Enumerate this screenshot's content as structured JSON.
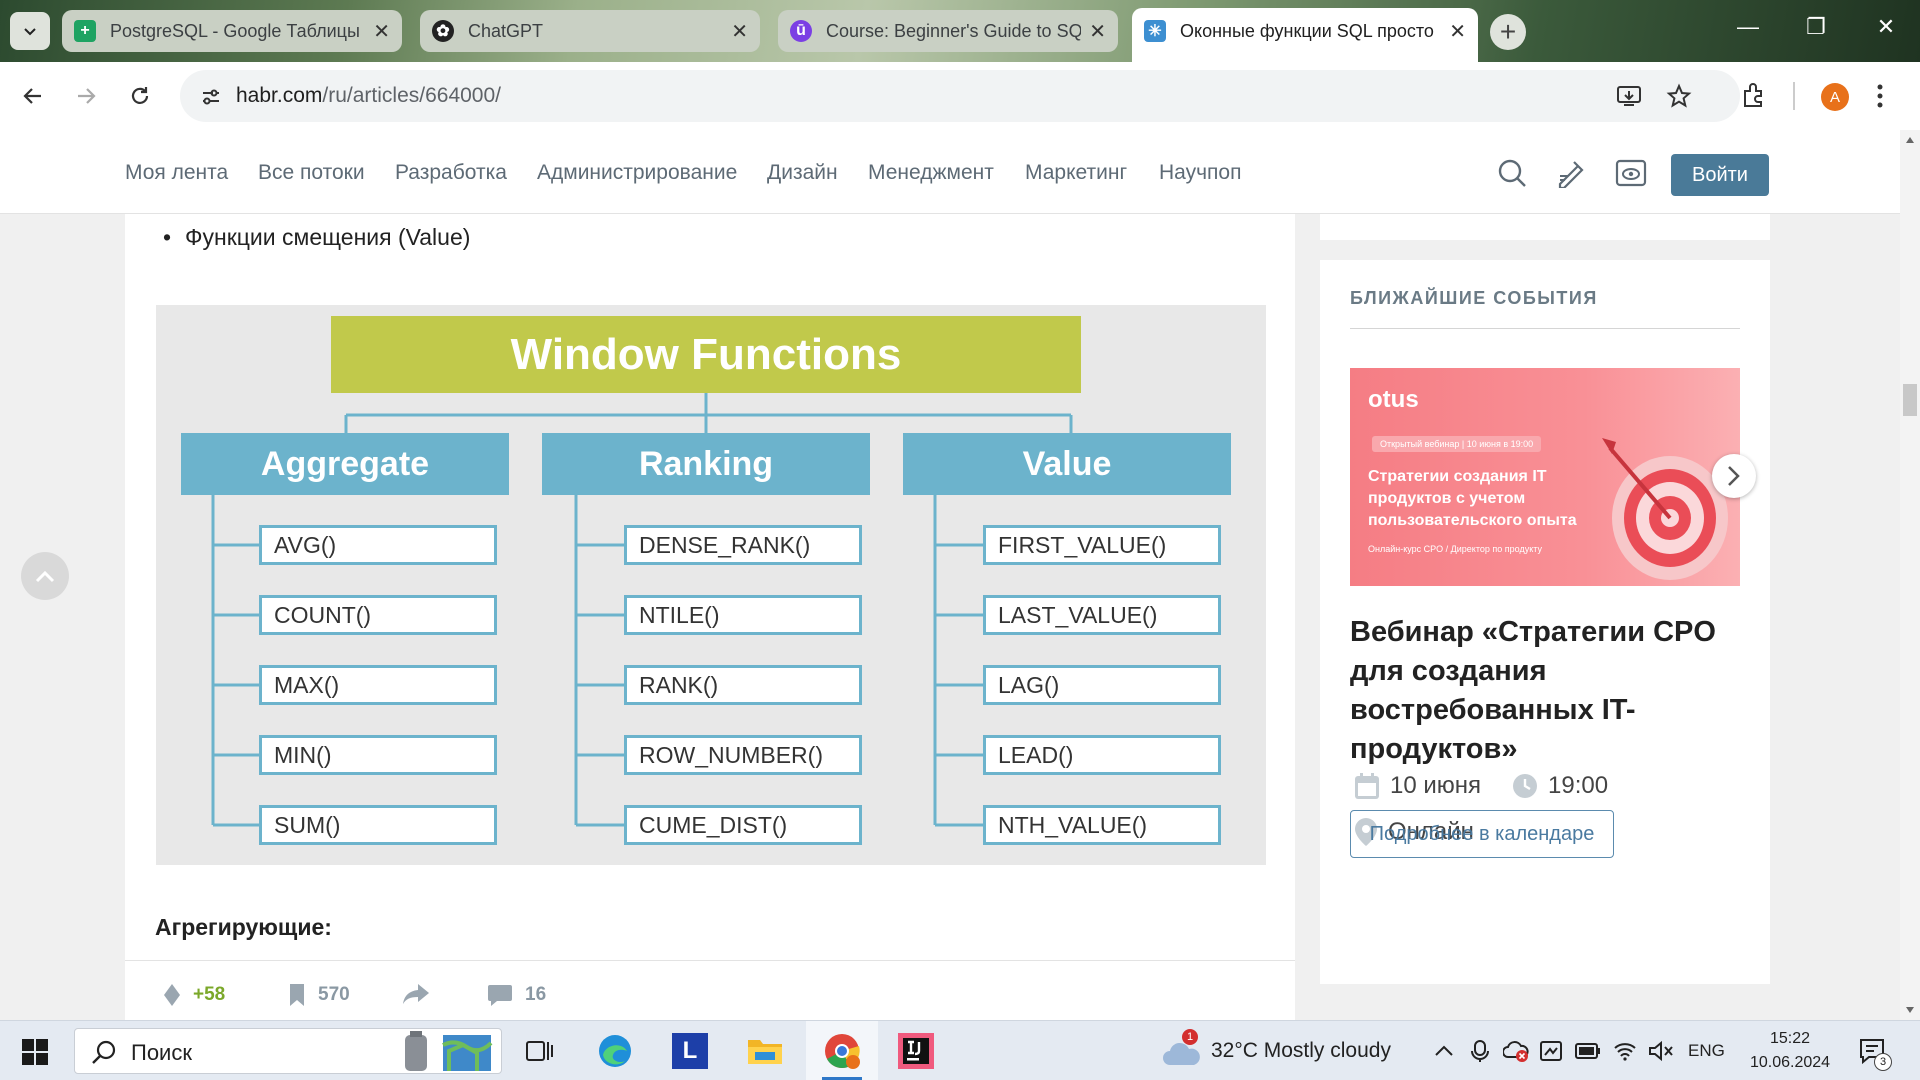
{
  "tabs": [
    {
      "title": "PostgreSQL - Google Таблицы",
      "favicon": "sheets-icon",
      "color": "#1ea362"
    },
    {
      "title": "ChatGPT",
      "favicon": "chatgpt-icon",
      "color": "#222222"
    },
    {
      "title": "Course: Beginner's Guide to SQL",
      "favicon": "course-icon",
      "color": "#7b3fe4"
    },
    {
      "title": "Оконные функции SQL просто",
      "favicon": "habr-icon",
      "color": "#3d8fd1"
    }
  ],
  "browser": {
    "url_host": "habr.com",
    "url_path": "/ru/articles/664000/",
    "profile_initial": "A"
  },
  "habr_nav": {
    "items": [
      "Моя лента",
      "Все потоки",
      "Разработка",
      "Администрирование",
      "Дизайн",
      "Менеджмент",
      "Маркетинг",
      "Научпоп"
    ],
    "login": "Войти"
  },
  "article": {
    "bullet": "Функции смещения (Value)",
    "diagram": {
      "title": "Window Functions",
      "categories": [
        {
          "name": "Aggregate",
          "items": [
            "AVG()",
            "COUNT()",
            "MAX()",
            "MIN()",
            "SUM()"
          ]
        },
        {
          "name": "Ranking",
          "items": [
            "DENSE_RANK()",
            "NTILE()",
            "RANK()",
            "ROW_NUMBER()",
            "CUME_DIST()"
          ]
        },
        {
          "name": "Value",
          "items": [
            "FIRST_VALUE()",
            "LAST_VALUE()",
            "LAG()",
            "LEAD()",
            "NTH_VALUE()"
          ]
        }
      ]
    },
    "section_heading": "Агрегирующие:",
    "stats": {
      "rating": "+58",
      "bookmarks": "570",
      "comments": "16"
    }
  },
  "sidebar": {
    "heading": "БЛИЖАЙШИЕ СОБЫТИЯ",
    "banner": {
      "logo": "otus",
      "pill": "Открытый вебинар | 10 июня в 19:00",
      "text": "Стратегии создания IT продуктов с учетом пользовательского опыта",
      "small": "Онлайн-курс CPO / Директор по продукту"
    },
    "event_title": "Вебинар «Стратегии CPO для создания востребованных IT-продуктов»",
    "date": "10 июня",
    "time": "19:00",
    "location": "Онлайн",
    "button": "Подробнее в календаре"
  },
  "taskbar": {
    "search": "Поиск",
    "weather_badge": "1",
    "weather": "32°C  Mostly cloudy",
    "lang": "ENG",
    "time": "15:22",
    "date": "10.06.2024",
    "notifications": "3"
  },
  "colors": {
    "habr_login": "#4a7a98",
    "diagram_title": "#c1c94b",
    "diagram_category": "#6cb3cc",
    "rating_green": "#7ba82a"
  }
}
